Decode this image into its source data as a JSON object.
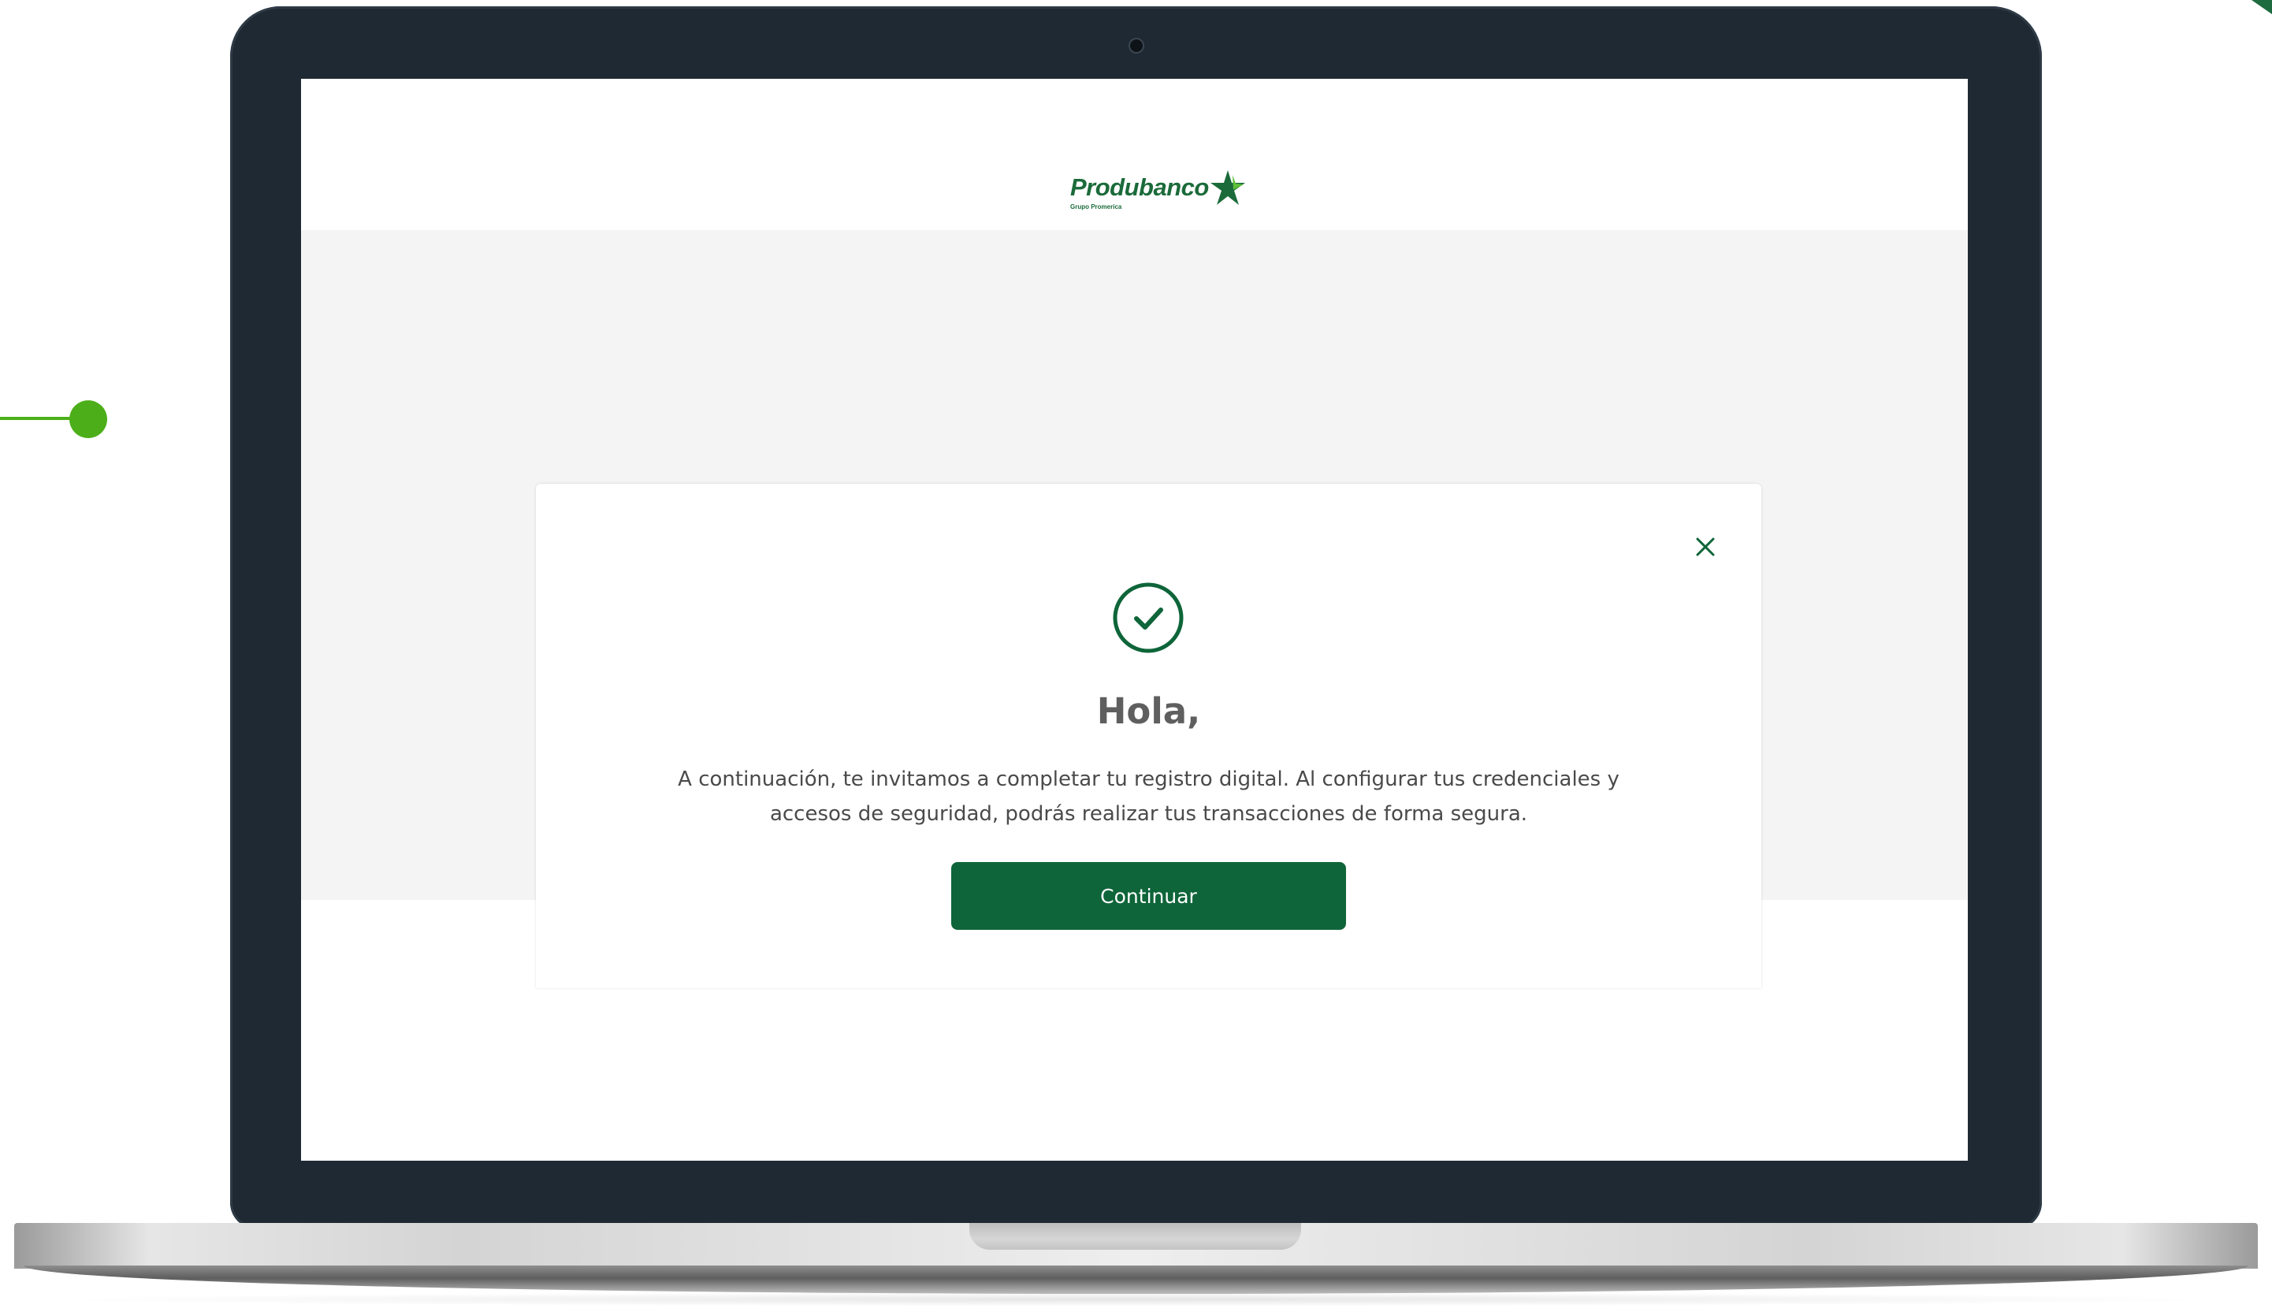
{
  "brand": {
    "name": "Produbanco",
    "sub": "Grupo Promerica",
    "color": "#1b6b3a"
  },
  "modal": {
    "title": "Hola,",
    "message": "A continuación, te invitamos a completar tu registro digital. Al configurar tus credenciales y accesos de seguridad, podrás realizar tus transacciones de forma segura.",
    "continue_label": "Continuar",
    "icons": {
      "status": "check-circle-icon",
      "close": "close-icon"
    }
  },
  "colors": {
    "primary_button": "#0e6539",
    "accent_green": "#4caf1a",
    "laptop_frame": "#1f2933"
  }
}
